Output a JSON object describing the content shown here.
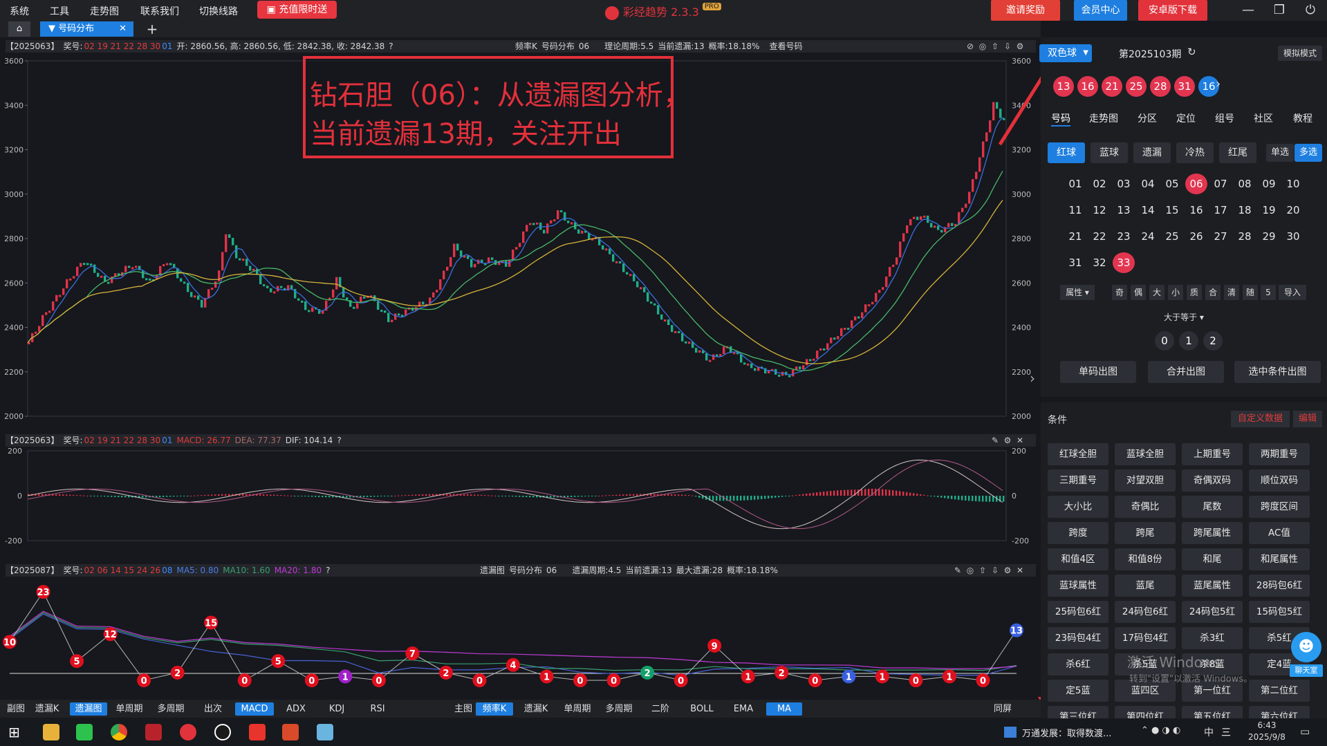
{
  "menu": [
    "系统",
    "工具",
    "走势图",
    "联系我们",
    "切换线路"
  ],
  "promo_label": "充值限时送",
  "app_title": "彩经趋势 2.3.3",
  "app_badge": "PRO",
  "top_buttons": {
    "invite": "邀请奖励",
    "member": "会员中心",
    "android": "安卓版下载"
  },
  "window_controls": [
    "—",
    "❐",
    "⏻"
  ],
  "tab": {
    "label": "号码分布",
    "close": "✕",
    "add": "+"
  },
  "main_chart": {
    "period": "【2025063】",
    "prize_label": "奖号:",
    "prize_red": "02 19 21 22 28 30",
    "prize_blue": "01",
    "ohlc": "开: 2860.56, 高: 2860.56, 低: 2842.38, 收: 2842.38",
    "center": [
      "频率K",
      "号码分布",
      "06",
      "理论周期:5.5",
      "当前遗漏:13",
      "概率:18.18%",
      "查看号码"
    ],
    "y_ticks": [
      "3600",
      "3400",
      "3200",
      "3000",
      "2800",
      "2600",
      "2400",
      "2200",
      "2000"
    ]
  },
  "annotation": {
    "line1": "钻石胆（06）：从遗漏图分析，",
    "line2": "当前遗漏13期，关注开出"
  },
  "macd_panel": {
    "period": "【2025063】",
    "prize_label": "奖号:",
    "prize_red": "02 19 21 22 28 30",
    "prize_blue": "01",
    "macd": "MACD: 26.77",
    "dea": "DEA: 77.37",
    "dif": "DIF: 104.14",
    "y_ticks": [
      "200",
      "0",
      "-200"
    ]
  },
  "miss_panel": {
    "period": "【2025087】",
    "prize_label": "奖号:",
    "prize_red": "02 06 14 15 24 26",
    "prize_blue": "08",
    "ma5": "MA5: 0.80",
    "ma10": "MA10: 1.60",
    "ma20": "MA20: 1.80",
    "center": [
      "遗漏图",
      "号码分布",
      "06",
      "遗漏周期:4.5",
      "当前遗漏:13",
      "最大遗漏:28",
      "概率:18.18%"
    ],
    "points": [
      10,
      23,
      5,
      12,
      0,
      2,
      15,
      0,
      5,
      0,
      1,
      0,
      7,
      2,
      0,
      4,
      1,
      0,
      0,
      2,
      0,
      9,
      1,
      2,
      0,
      1,
      1,
      0,
      1,
      0,
      13
    ]
  },
  "bottom_bar": {
    "sub_label": "副图",
    "sub": [
      "遗漏K",
      "遗漏图",
      "单周期",
      "多周期",
      "出次",
      "MACD",
      "ADX",
      "KDJ",
      "RSI"
    ],
    "main_label": "主图",
    "main": [
      "频率K",
      "遗漏K",
      "单周期",
      "多周期",
      "二阶",
      "BOLL",
      "EMA",
      "MA"
    ],
    "same_screen": "同屏"
  },
  "right_panel": {
    "lottery": "双色球",
    "issue": "第2025103期",
    "mode": "模拟模式",
    "red_balls": [
      "13",
      "16",
      "21",
      "25",
      "28",
      "31"
    ],
    "blue_ball": "16",
    "nav": [
      "号码",
      "走势图",
      "分区",
      "定位",
      "组号",
      "社区",
      "教程"
    ],
    "filters": [
      "红球",
      "蓝球",
      "遗漏",
      "冷热",
      "红尾"
    ],
    "single": "单选",
    "multi": "多选",
    "numbers": [
      "01",
      "02",
      "03",
      "04",
      "05",
      "06",
      "07",
      "08",
      "09",
      "10",
      "11",
      "12",
      "13",
      "14",
      "15",
      "16",
      "17",
      "18",
      "19",
      "20",
      "21",
      "22",
      "23",
      "24",
      "25",
      "26",
      "27",
      "28",
      "29",
      "30",
      "31",
      "32",
      "33"
    ],
    "selected": [
      "06",
      "33"
    ],
    "attr_label": "属性",
    "attrs": [
      "奇",
      "偶",
      "大",
      "小",
      "质",
      "合",
      "清",
      "随",
      "5",
      "导入"
    ],
    "compare": "大于等于",
    "counts": [
      "0",
      "1",
      "2"
    ],
    "actions": [
      "单码出图",
      "合并出图",
      "选中条件出图"
    ],
    "cond_label": "条件",
    "custom": "自定义数据",
    "edit": "编辑",
    "conditions": [
      "红球全胆",
      "蓝球全胆",
      "上期重号",
      "两期重号",
      "三期重号",
      "对望双胆",
      "奇偶双码",
      "顺位双码",
      "大小比",
      "奇偶比",
      "尾数",
      "跨度区间",
      "跨度",
      "跨尾",
      "跨尾属性",
      "AC值",
      "和值4区",
      "和值8份",
      "和尾",
      "和尾属性",
      "蓝球属性",
      "蓝尾",
      "蓝尾属性",
      "28码包6红",
      "25码包6红",
      "24码包6红",
      "24码包5红",
      "15码包5红",
      "23码包4红",
      "17码包4红",
      "杀3红",
      "杀5红",
      "杀6红",
      "杀5蓝",
      "杀8蓝",
      "定4蓝",
      "定5蓝",
      "蓝四区",
      "第一位红",
      "第二位红",
      "第三位红",
      "第四位红",
      "第五位红",
      "第六位红"
    ],
    "watermark1": "激活 Windows",
    "watermark2": "转到\"设置\"以激活 Windows。",
    "chat": "聊天室"
  },
  "taskbar": {
    "news": "万通发展：取得数渡...",
    "ime": "中",
    "time": "6:43",
    "date": "2025/9/8"
  },
  "colors": {
    "red": "#e23550",
    "blue": "#1e7fe0",
    "annot": "#e3303a"
  }
}
